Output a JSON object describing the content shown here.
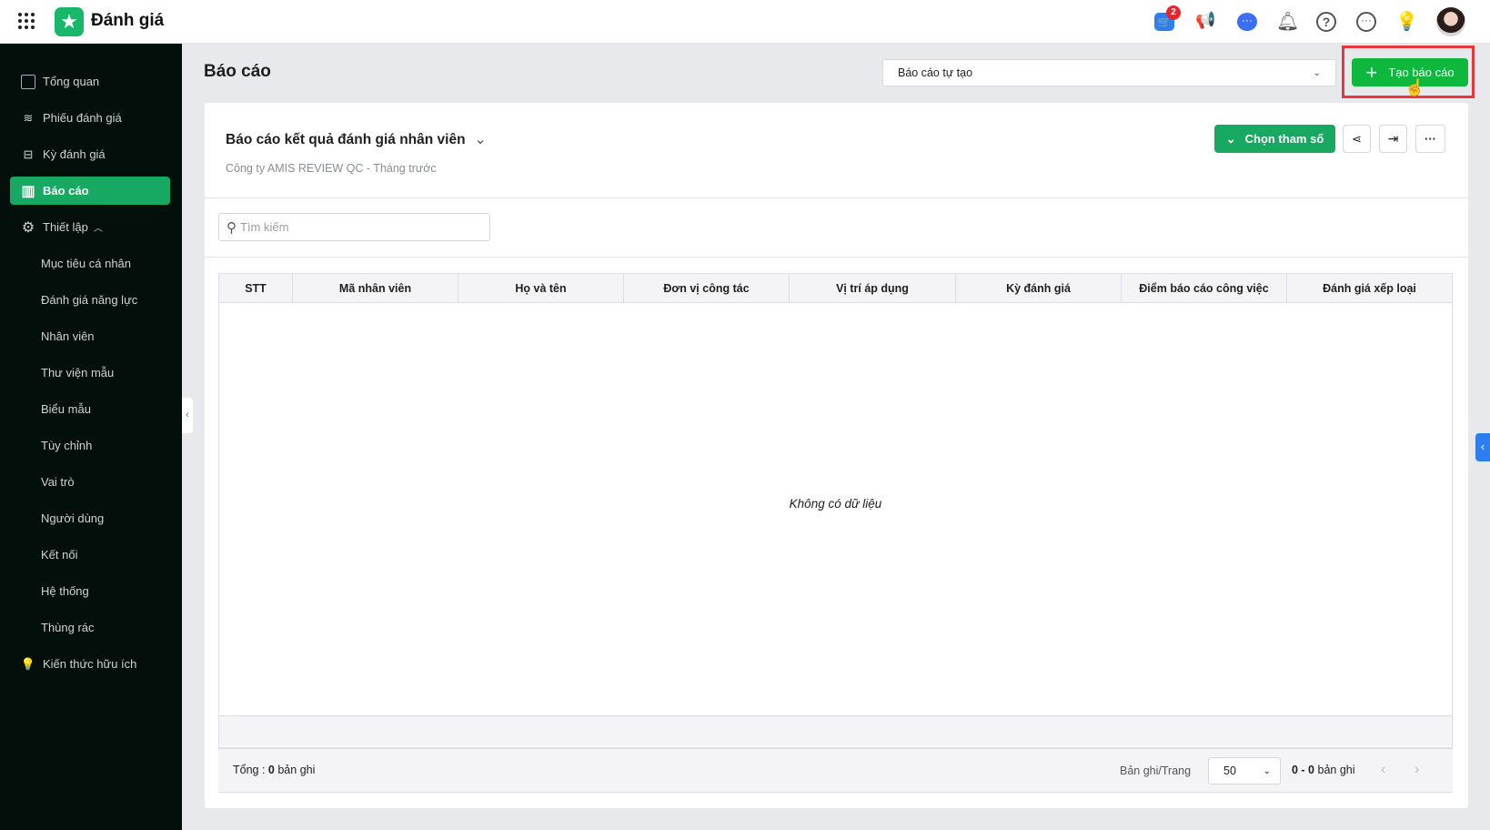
{
  "app": {
    "title": "Đánh giá",
    "cart_badge": "2"
  },
  "sidebar": {
    "items": [
      {
        "label": "Tổng quan",
        "icon": "chart-icon"
      },
      {
        "label": "Phiếu đánh giá",
        "icon": "layers-icon"
      },
      {
        "label": "Kỳ đánh giá",
        "icon": "board-icon"
      },
      {
        "label": "Báo cáo",
        "icon": "bar-chart-icon",
        "active": true
      },
      {
        "label": "Thiết lập",
        "icon": "gear-icon"
      },
      {
        "label": "Mục tiêu cá nhân"
      },
      {
        "label": "Đánh giá năng lực"
      },
      {
        "label": "Nhân viên"
      },
      {
        "label": "Thư viện mẫu"
      },
      {
        "label": "Biểu mẫu"
      },
      {
        "label": "Tùy chỉnh"
      },
      {
        "label": "Vai trò"
      },
      {
        "label": "Người dùng"
      },
      {
        "label": "Kết nối"
      },
      {
        "label": "Hệ thống"
      },
      {
        "label": "Thùng rác"
      },
      {
        "label": "Kiến thức hữu ích",
        "icon": "lightbulb-icon"
      }
    ]
  },
  "page": {
    "title": "Báo cáo",
    "report_select": "Báo cáo tự tạo",
    "create_button": "Tạo báo cáo"
  },
  "report": {
    "title": "Báo cáo kết quả đánh giá nhân viên",
    "subtitle": "Công ty AMIS REVIEW QC - Tháng trước",
    "params_button": "Chọn tham số",
    "search_placeholder": "Tìm kiếm"
  },
  "table": {
    "columns": [
      "STT",
      "Mã nhân viên",
      "Họ và tên",
      "Đơn vị công tác",
      "Vị trí áp dụng",
      "Kỳ đánh giá",
      "Điểm báo cáo công việc",
      "Đánh giá xếp loại"
    ],
    "empty": "Không có dữ liệu"
  },
  "footer": {
    "total_label": "Tổng :",
    "total": "0",
    "records_label": "bản ghi",
    "per_page_label": "Bản ghi/Trang",
    "per_page": "50",
    "range": "0 - 0",
    "range_suffix": "bản ghi"
  },
  "colors": {
    "accent": "#17a862",
    "create": "#0db83c",
    "sidebar": "#020f0b"
  }
}
